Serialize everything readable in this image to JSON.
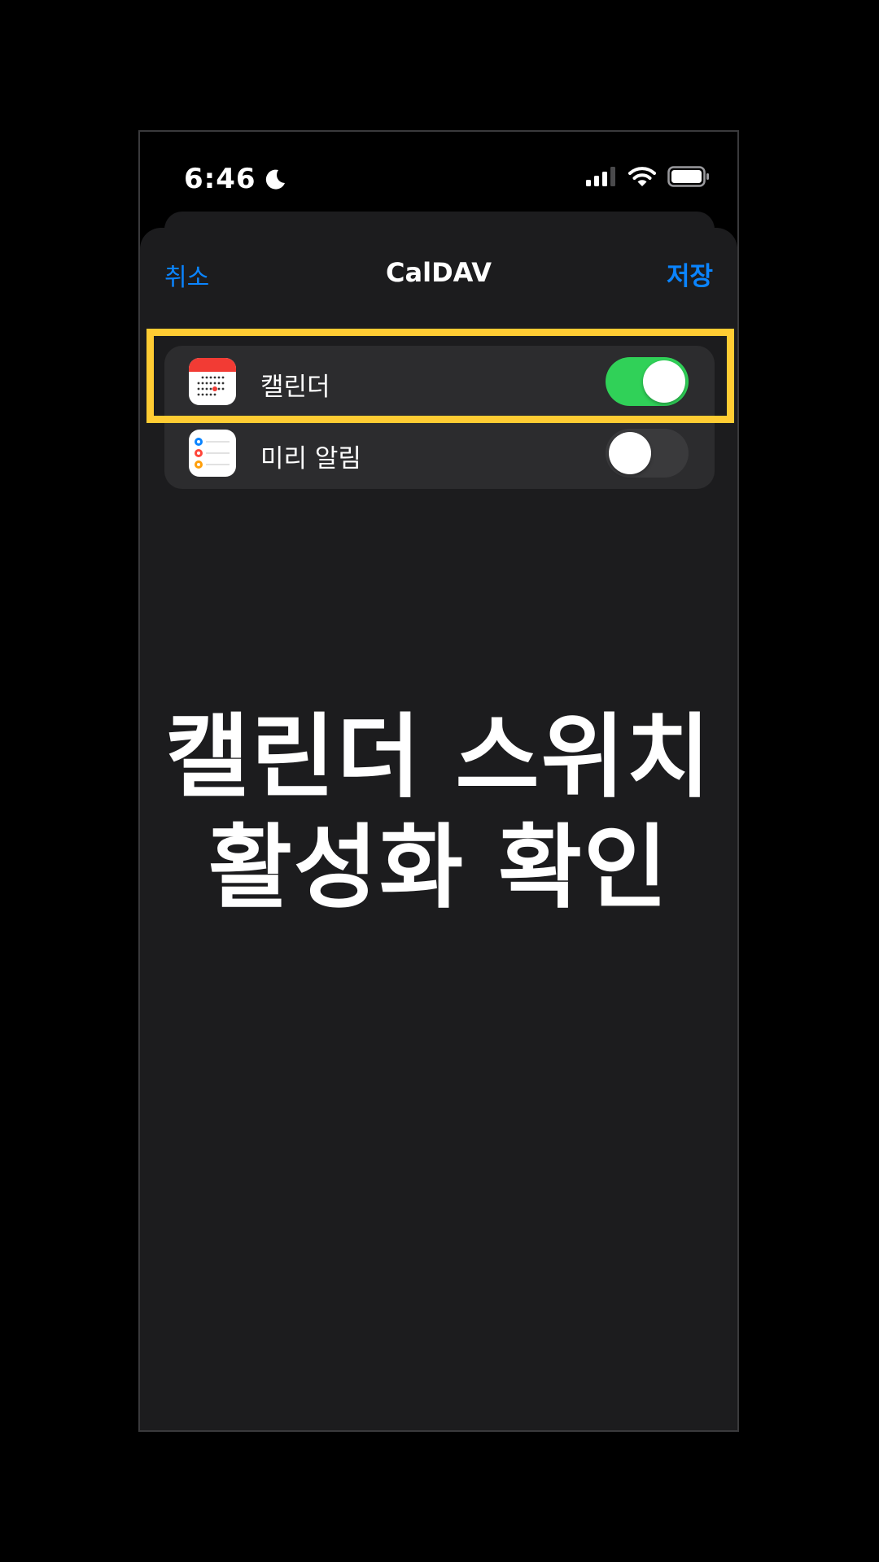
{
  "status_bar": {
    "time": "6:46",
    "icons": [
      "moon-icon",
      "cellular-signal-icon",
      "wifi-icon",
      "battery-icon"
    ]
  },
  "nav": {
    "cancel_label": "취소",
    "title": "CalDAV",
    "save_label": "저장"
  },
  "settings": [
    {
      "label": "캘린더",
      "icon": "calendar-app-icon",
      "enabled": true
    },
    {
      "label": "미리 알림",
      "icon": "reminders-app-icon",
      "enabled": false
    }
  ],
  "caption": {
    "line1": "캘린더 스위치",
    "line2": "활성화 확인"
  },
  "colors": {
    "accent_blue": "#0a84ff",
    "toggle_on": "#30d158",
    "highlight": "#ffcc33",
    "sheet_bg": "#1c1c1e",
    "group_bg": "#2c2c2e"
  }
}
